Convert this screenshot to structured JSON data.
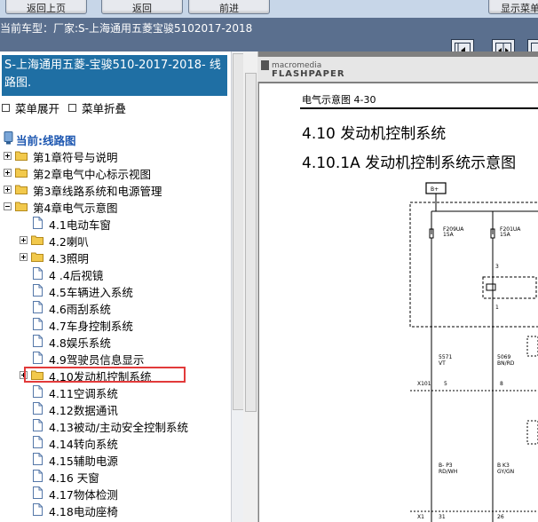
{
  "top_buttons": [
    "返回上页",
    "返回",
    "前进"
  ],
  "top_right_button": "显示菜单",
  "car_model": "当前车型：厂家:S-上海通用五菱宝骏5102017-2018",
  "tree": {
    "title": "S-上海通用五菱-宝骏510-2017-2018- 线路图.",
    "expand_all": "菜单展开",
    "collapse_all": "菜单折叠",
    "current": "当前:线路图",
    "items": [
      {
        "label": "第1章符号与说明",
        "type": "folder",
        "level": 0,
        "state": "collapsed"
      },
      {
        "label": "第2章电气中心标示视图",
        "type": "folder",
        "level": 0,
        "state": "collapsed"
      },
      {
        "label": "第3章线路系统和电源管理",
        "type": "folder",
        "level": 0,
        "state": "collapsed"
      },
      {
        "label": "第4章电气示意图",
        "type": "folder",
        "level": 0,
        "state": "expanded"
      },
      {
        "label": "4.1电动车窗",
        "type": "doc",
        "level": 1
      },
      {
        "label": "4.2喇叭",
        "type": "folder",
        "level": 1,
        "state": "collapsed"
      },
      {
        "label": "4.3照明",
        "type": "folder",
        "level": 1,
        "state": "collapsed"
      },
      {
        "label": "4 .4后视镜",
        "type": "doc",
        "level": 1
      },
      {
        "label": "4.5车辆进入系统",
        "type": "doc",
        "level": 1
      },
      {
        "label": "4.6雨刮系统",
        "type": "doc",
        "level": 1
      },
      {
        "label": "4.7车身控制系统",
        "type": "doc",
        "level": 1
      },
      {
        "label": "4.8娱乐系统",
        "type": "doc",
        "level": 1
      },
      {
        "label": "4.9驾驶员信息显示",
        "type": "doc",
        "level": 1
      },
      {
        "label": "4.10发动机控制系统",
        "type": "folder",
        "level": 1,
        "state": "collapsed",
        "selected": true
      },
      {
        "label": "4.11空调系统",
        "type": "doc",
        "level": 1
      },
      {
        "label": "4.12数据通讯",
        "type": "doc",
        "level": 1
      },
      {
        "label": "4.13被动/主动安全控制系统",
        "type": "doc",
        "level": 1
      },
      {
        "label": "4.14转向系统",
        "type": "doc",
        "level": 1
      },
      {
        "label": "4.15辅助电源",
        "type": "doc",
        "level": 1
      },
      {
        "label": "4.16 天窗",
        "type": "doc",
        "level": 1
      },
      {
        "label": "4.17物体检测",
        "type": "doc",
        "level": 1
      },
      {
        "label": "4.18电动座椅",
        "type": "doc",
        "level": 1
      }
    ]
  },
  "viewer": {
    "logo_top": "macromedia",
    "logo_bottom": "FLASHPAPER",
    "page_header": "电气示意图 4-30",
    "heading1": "4.10 发动机控制系统",
    "heading2": "4.10.1A 发动机控制系统示意图",
    "diagram": {
      "supply": "B+",
      "fuse1": "F209UA",
      "fuse1_rating": "15A",
      "fuse2": "F201UA",
      "fuse2_rating": "15A",
      "relay_pin_top": "3",
      "relay_pin_bottom": "1",
      "wire1_id": "5571",
      "wire1_color": "VT",
      "wire2_id": "5069",
      "wire2_color": "BN/RD",
      "connector1": "X101",
      "connector1_pin1": "5",
      "connector1_pin2": "8",
      "wire3_id": "B- P3",
      "wire3_color": "RD/WH",
      "wire4_id": "B K3",
      "wire4_color": "GY/GN",
      "connector2": "X1",
      "connector2_pin1": "31",
      "connector2_pin2": "26"
    }
  },
  "colors": {
    "tree_title_bg": "#1f6fa4",
    "model_bar_bg": "#5a6f8e",
    "highlight": "#e23a3a",
    "current_label": "#1c56b0"
  }
}
